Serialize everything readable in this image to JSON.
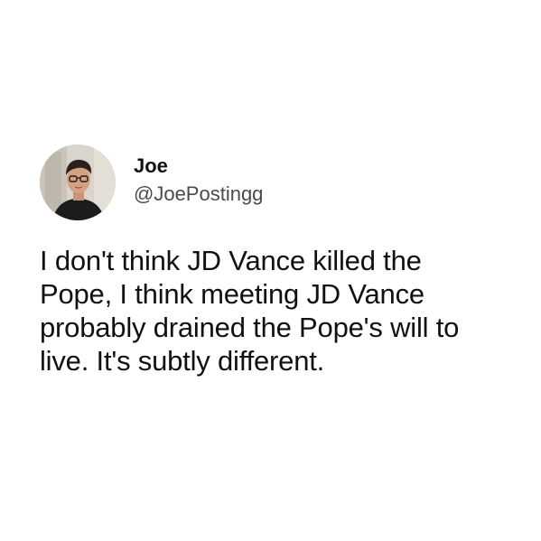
{
  "post": {
    "author": {
      "display_name": "Joe",
      "handle": "@JoePostingg",
      "avatar": "profile-photo"
    },
    "text": "I don't think JD Vance killed the Pope, I think meeting JD Vance probably drained the Pope's will to live. It's subtly different."
  },
  "colors": {
    "background": "#ffffff",
    "text": "#111111",
    "handle": "#4a4a4a"
  }
}
